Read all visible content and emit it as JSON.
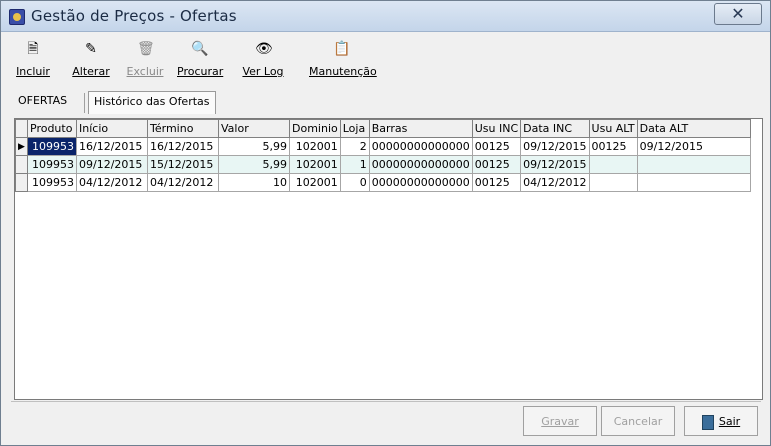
{
  "window": {
    "title": "Gestão de Preços - Ofertas",
    "close_glyph": "✕"
  },
  "toolbar": {
    "items": [
      {
        "label": "Incluir",
        "icon": "new-document-icon",
        "glyph": "🗎",
        "enabled": true
      },
      {
        "label": "Alterar",
        "icon": "edit-document-icon",
        "glyph": "✎",
        "enabled": true
      },
      {
        "label": "Excluir",
        "icon": "trash-icon",
        "glyph": "🗑",
        "enabled": false
      },
      {
        "label": "Procurar",
        "icon": "search-globe-icon",
        "glyph": "🔍",
        "enabled": true
      },
      {
        "label": "Ver Log",
        "icon": "eye-icon",
        "glyph": "👁",
        "enabled": true
      },
      {
        "label": "Manutenção",
        "icon": "documents-icon",
        "glyph": "📋",
        "enabled": true
      }
    ]
  },
  "tabs": [
    {
      "label": "OFERTAS",
      "active": false
    },
    {
      "label": "Histórico das Ofertas",
      "active": true
    }
  ],
  "grid": {
    "columns": [
      "Produto",
      "Início",
      "Término",
      "Valor",
      "Dominio",
      "Loja",
      "Barras",
      "Usu INC",
      "Data INC",
      "Usu ALT",
      "Data ALT"
    ],
    "rows": [
      [
        "109953",
        "16/12/2015",
        "16/12/2015",
        "5,99",
        "102001",
        "2",
        "00000000000000",
        "00125",
        "09/12/2015",
        "00125",
        "09/12/2015"
      ],
      [
        "109953",
        "09/12/2015",
        "15/12/2015",
        "5,99",
        "102001",
        "1",
        "00000000000000",
        "00125",
        "09/12/2015",
        "",
        ""
      ],
      [
        "109953",
        "04/12/2012",
        "04/12/2012",
        "10",
        "102001",
        "0",
        "00000000000000",
        "00125",
        "04/12/2012",
        "",
        ""
      ]
    ],
    "current_row_marker": "▶"
  },
  "footer": {
    "gravar": "Gravar",
    "cancelar": "Cancelar",
    "sair": "Sair"
  }
}
